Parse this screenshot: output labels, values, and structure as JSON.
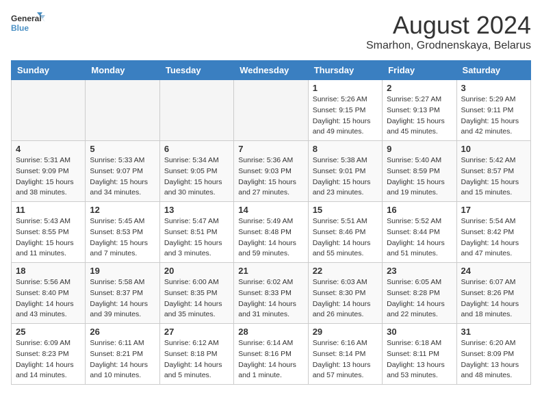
{
  "logo": {
    "text_general": "General",
    "text_blue": "Blue"
  },
  "title": {
    "month_year": "August 2024",
    "location": "Smarhon, Grodnenskaya, Belarus"
  },
  "weekdays": [
    "Sunday",
    "Monday",
    "Tuesday",
    "Wednesday",
    "Thursday",
    "Friday",
    "Saturday"
  ],
  "weeks": [
    [
      {
        "day": "",
        "info": ""
      },
      {
        "day": "",
        "info": ""
      },
      {
        "day": "",
        "info": ""
      },
      {
        "day": "",
        "info": ""
      },
      {
        "day": "1",
        "info": "Sunrise: 5:26 AM\nSunset: 9:15 PM\nDaylight: 15 hours\nand 49 minutes."
      },
      {
        "day": "2",
        "info": "Sunrise: 5:27 AM\nSunset: 9:13 PM\nDaylight: 15 hours\nand 45 minutes."
      },
      {
        "day": "3",
        "info": "Sunrise: 5:29 AM\nSunset: 9:11 PM\nDaylight: 15 hours\nand 42 minutes."
      }
    ],
    [
      {
        "day": "4",
        "info": "Sunrise: 5:31 AM\nSunset: 9:09 PM\nDaylight: 15 hours\nand 38 minutes."
      },
      {
        "day": "5",
        "info": "Sunrise: 5:33 AM\nSunset: 9:07 PM\nDaylight: 15 hours\nand 34 minutes."
      },
      {
        "day": "6",
        "info": "Sunrise: 5:34 AM\nSunset: 9:05 PM\nDaylight: 15 hours\nand 30 minutes."
      },
      {
        "day": "7",
        "info": "Sunrise: 5:36 AM\nSunset: 9:03 PM\nDaylight: 15 hours\nand 27 minutes."
      },
      {
        "day": "8",
        "info": "Sunrise: 5:38 AM\nSunset: 9:01 PM\nDaylight: 15 hours\nand 23 minutes."
      },
      {
        "day": "9",
        "info": "Sunrise: 5:40 AM\nSunset: 8:59 PM\nDaylight: 15 hours\nand 19 minutes."
      },
      {
        "day": "10",
        "info": "Sunrise: 5:42 AM\nSunset: 8:57 PM\nDaylight: 15 hours\nand 15 minutes."
      }
    ],
    [
      {
        "day": "11",
        "info": "Sunrise: 5:43 AM\nSunset: 8:55 PM\nDaylight: 15 hours\nand 11 minutes."
      },
      {
        "day": "12",
        "info": "Sunrise: 5:45 AM\nSunset: 8:53 PM\nDaylight: 15 hours\nand 7 minutes."
      },
      {
        "day": "13",
        "info": "Sunrise: 5:47 AM\nSunset: 8:51 PM\nDaylight: 15 hours\nand 3 minutes."
      },
      {
        "day": "14",
        "info": "Sunrise: 5:49 AM\nSunset: 8:48 PM\nDaylight: 14 hours\nand 59 minutes."
      },
      {
        "day": "15",
        "info": "Sunrise: 5:51 AM\nSunset: 8:46 PM\nDaylight: 14 hours\nand 55 minutes."
      },
      {
        "day": "16",
        "info": "Sunrise: 5:52 AM\nSunset: 8:44 PM\nDaylight: 14 hours\nand 51 minutes."
      },
      {
        "day": "17",
        "info": "Sunrise: 5:54 AM\nSunset: 8:42 PM\nDaylight: 14 hours\nand 47 minutes."
      }
    ],
    [
      {
        "day": "18",
        "info": "Sunrise: 5:56 AM\nSunset: 8:40 PM\nDaylight: 14 hours\nand 43 minutes."
      },
      {
        "day": "19",
        "info": "Sunrise: 5:58 AM\nSunset: 8:37 PM\nDaylight: 14 hours\nand 39 minutes."
      },
      {
        "day": "20",
        "info": "Sunrise: 6:00 AM\nSunset: 8:35 PM\nDaylight: 14 hours\nand 35 minutes."
      },
      {
        "day": "21",
        "info": "Sunrise: 6:02 AM\nSunset: 8:33 PM\nDaylight: 14 hours\nand 31 minutes."
      },
      {
        "day": "22",
        "info": "Sunrise: 6:03 AM\nSunset: 8:30 PM\nDaylight: 14 hours\nand 26 minutes."
      },
      {
        "day": "23",
        "info": "Sunrise: 6:05 AM\nSunset: 8:28 PM\nDaylight: 14 hours\nand 22 minutes."
      },
      {
        "day": "24",
        "info": "Sunrise: 6:07 AM\nSunset: 8:26 PM\nDaylight: 14 hours\nand 18 minutes."
      }
    ],
    [
      {
        "day": "25",
        "info": "Sunrise: 6:09 AM\nSunset: 8:23 PM\nDaylight: 14 hours\nand 14 minutes."
      },
      {
        "day": "26",
        "info": "Sunrise: 6:11 AM\nSunset: 8:21 PM\nDaylight: 14 hours\nand 10 minutes."
      },
      {
        "day": "27",
        "info": "Sunrise: 6:12 AM\nSunset: 8:18 PM\nDaylight: 14 hours\nand 5 minutes."
      },
      {
        "day": "28",
        "info": "Sunrise: 6:14 AM\nSunset: 8:16 PM\nDaylight: 14 hours\nand 1 minute."
      },
      {
        "day": "29",
        "info": "Sunrise: 6:16 AM\nSunset: 8:14 PM\nDaylight: 13 hours\nand 57 minutes."
      },
      {
        "day": "30",
        "info": "Sunrise: 6:18 AM\nSunset: 8:11 PM\nDaylight: 13 hours\nand 53 minutes."
      },
      {
        "day": "31",
        "info": "Sunrise: 6:20 AM\nSunset: 8:09 PM\nDaylight: 13 hours\nand 48 minutes."
      }
    ]
  ]
}
